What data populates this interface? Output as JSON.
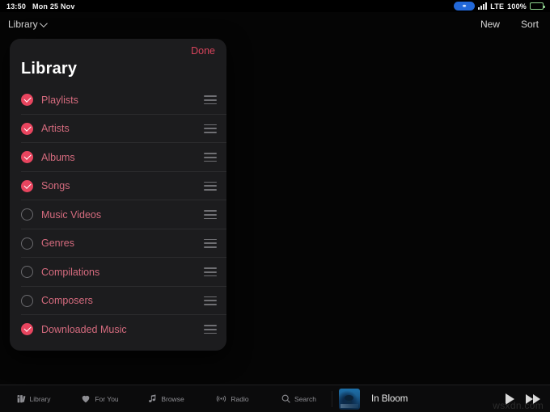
{
  "status_bar": {
    "time": "13:50",
    "date": "Mon 25 Nov",
    "recording_icon": "screen-recording-icon",
    "signal_icon": "cellular-signal-icon",
    "network": "LTE",
    "battery_percent": "100%",
    "battery_icon": "battery-full-icon"
  },
  "nav_bar": {
    "left_label": "Library",
    "left_chevron_icon": "chevron-down-icon",
    "new_label": "New",
    "sort_label": "Sort"
  },
  "panel": {
    "done_label": "Done",
    "title": "Library",
    "accent_color": "#e8455f",
    "done_color": "#d8445c",
    "label_color": "#d56b7e",
    "background_color": "#1c1c1e",
    "items": [
      {
        "label": "Playlists",
        "checked": true,
        "handle_icon": "drag-handle-icon"
      },
      {
        "label": "Artists",
        "checked": true,
        "handle_icon": "drag-handle-icon"
      },
      {
        "label": "Albums",
        "checked": true,
        "handle_icon": "drag-handle-icon"
      },
      {
        "label": "Songs",
        "checked": true,
        "handle_icon": "drag-handle-icon"
      },
      {
        "label": "Music Videos",
        "checked": false,
        "handle_icon": "drag-handle-icon"
      },
      {
        "label": "Genres",
        "checked": false,
        "handle_icon": "drag-handle-icon"
      },
      {
        "label": "Compilations",
        "checked": false,
        "handle_icon": "drag-handle-icon"
      },
      {
        "label": "Composers",
        "checked": false,
        "handle_icon": "drag-handle-icon"
      },
      {
        "label": "Downloaded Music",
        "checked": true,
        "handle_icon": "drag-handle-icon"
      }
    ]
  },
  "tab_bar": {
    "tabs": [
      {
        "label": "Library",
        "icon": "library-icon"
      },
      {
        "label": "For You",
        "icon": "heart-icon"
      },
      {
        "label": "Browse",
        "icon": "music-note-icon"
      },
      {
        "label": "Radio",
        "icon": "radio-broadcast-icon"
      },
      {
        "label": "Search",
        "icon": "search-icon"
      }
    ]
  },
  "now_playing": {
    "artwork_icon": "album-artwork",
    "title": "In Bloom",
    "play_icon": "play-icon",
    "next_icon": "fast-forward-icon"
  },
  "watermark": {
    "text": "wsxdn.com"
  }
}
